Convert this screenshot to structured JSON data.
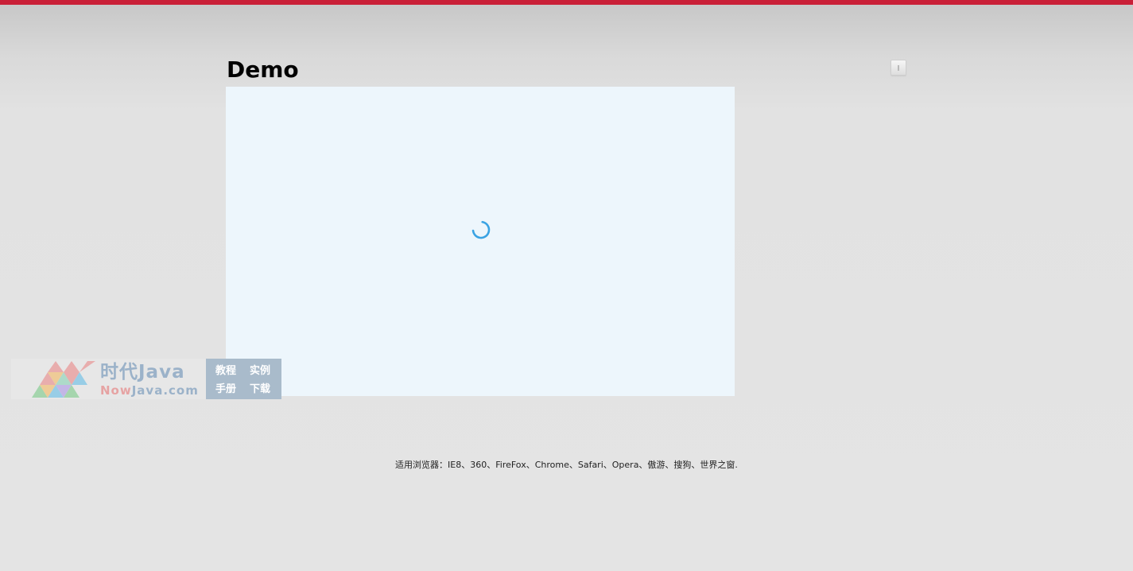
{
  "page": {
    "title": "Demo",
    "footer_text": "适用浏览器：IE8、360、FireFox、Chrome、Safari、Opera、傲游、搜狗、世界之窗."
  },
  "watermark": {
    "brand": "时代Java",
    "domain_prefix": "Now",
    "domain_rest": "Java.com",
    "links": [
      "教程",
      "实例",
      "手册",
      "下载"
    ]
  },
  "icons": {
    "spinner": "loading-spinner-icon",
    "corner": "small-button-icon"
  },
  "colors": {
    "top_bar": "#c91f37",
    "panel": "#edf6fc",
    "spinner": "#3aa3e3"
  }
}
